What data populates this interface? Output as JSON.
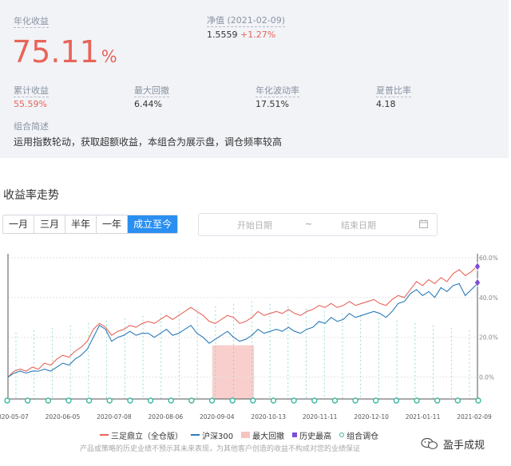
{
  "summary": {
    "annual_return_label": "年化收益",
    "annual_return_value": "75.11",
    "annual_return_unit": "%",
    "nav_label": "净值 (2021-02-09)",
    "nav_value": "1.5559",
    "nav_change": "+1.27%",
    "metrics": [
      {
        "label": "累计收益",
        "value": "55.59%"
      },
      {
        "label": "最大回撤",
        "value": "6.44%"
      },
      {
        "label": "年化波动率",
        "value": "17.51%"
      },
      {
        "label": "夏普比率",
        "value": "4.18"
      }
    ],
    "desc_label": "组合简述",
    "desc_text": "运用指数轮动，获取超额收益，本组合为展示盘，调仓频率较高"
  },
  "chart_section": {
    "title": "收益率走势",
    "ranges": [
      "一月",
      "三月",
      "半年",
      "一年",
      "成立至今"
    ],
    "active_range": "成立至今",
    "start_placeholder": "开始日期",
    "separator": "~",
    "end_placeholder": "结束日期"
  },
  "legend": {
    "strategy": "三足鼎立（全仓版）",
    "benchmark": "沪深300",
    "max_drawdown": "最大回撤",
    "history_high": "历史最高",
    "rebalance": "组合调仓"
  },
  "disclaimer": "产品或策略的历史业绩不预示其未来表现，为其他客户创造的收益不构成对您的业绩保证",
  "watermark": "盈手成规",
  "colors": {
    "strategy": "#e8645a",
    "benchmark": "#2b7bb9",
    "drawdown": "#f6c3c0",
    "high": "#7b4fd6",
    "rebalance": "#3cb9a0",
    "accent": "#2a8ff0"
  },
  "chart_data": {
    "type": "line",
    "x_tick_labels": [
      "2020-05-07",
      "2020-06-05",
      "2020-07-08",
      "2020-08-06",
      "2020-09-04",
      "2020-10-13",
      "2020-11-11",
      "2020-12-10",
      "2021-01-11",
      "2021-02-09"
    ],
    "y_tick_labels": [
      "0.0%",
      "20.0%",
      "40.0%",
      "60.0%"
    ],
    "ylim": [
      -11,
      62
    ],
    "series": [
      {
        "name": "三足鼎立（全仓版）",
        "values": [
          0,
          3,
          4,
          3,
          5,
          4,
          7,
          6,
          9,
          11,
          10,
          13,
          15,
          18,
          24,
          27,
          25,
          21,
          23,
          24,
          26,
          25,
          27,
          28,
          27,
          29,
          31,
          29,
          31,
          33,
          35,
          33,
          31,
          28,
          27,
          29,
          31,
          30,
          27,
          28,
          30,
          33,
          31,
          32,
          33,
          32,
          34,
          32,
          31,
          33,
          34,
          36,
          35,
          37,
          35,
          36,
          38,
          36,
          37,
          38,
          39,
          37,
          36,
          39,
          41,
          40,
          44,
          48,
          46,
          49,
          47,
          50,
          48,
          52,
          54,
          51,
          53,
          56
        ]
      },
      {
        "name": "沪深300",
        "values": [
          0,
          2,
          3,
          2,
          3,
          3,
          4,
          3,
          5,
          7,
          6,
          9,
          11,
          14,
          20,
          26,
          24,
          18,
          20,
          21,
          23,
          21,
          22,
          22,
          20,
          22,
          24,
          21,
          22,
          24,
          26,
          22,
          20,
          17,
          19,
          21,
          23,
          20,
          18,
          19,
          21,
          24,
          22,
          23,
          24,
          23,
          25,
          23,
          22,
          24,
          25,
          28,
          27,
          30,
          28,
          29,
          32,
          30,
          31,
          32,
          33,
          32,
          30,
          33,
          37,
          38,
          42,
          44,
          41,
          43,
          40,
          45,
          43,
          46,
          47,
          41,
          44,
          47
        ]
      }
    ],
    "max_drawdown_period": [
      "2020-09-04",
      "2020-10-13"
    ],
    "history_high": [
      55.59,
      47.5
    ]
  }
}
